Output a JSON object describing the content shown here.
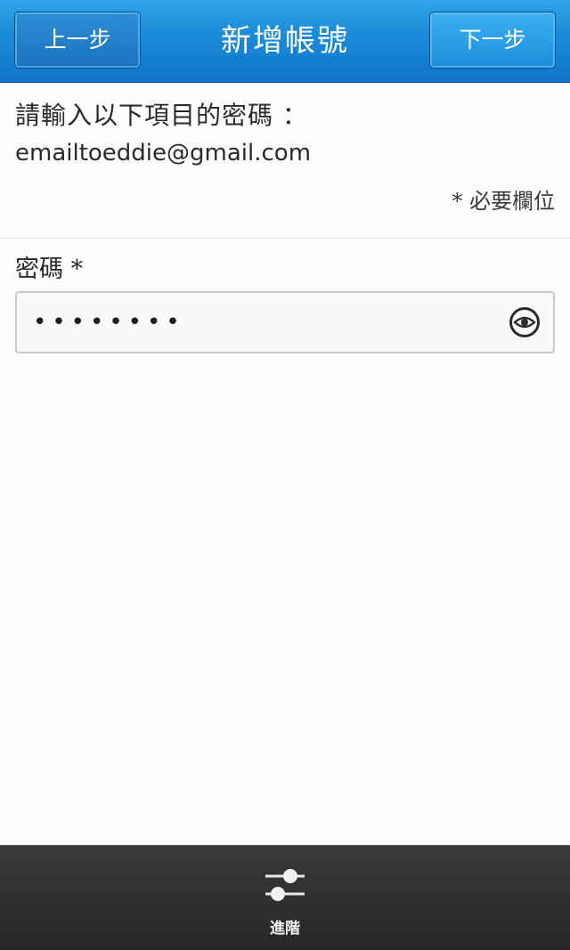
{
  "titlebar": {
    "back_label": "上一步",
    "title": "新增帳號",
    "next_label": "下一步"
  },
  "prompt": {
    "line1": "請輸入以下項目的密碼 ：",
    "email": "emailtoeddie@gmail.com"
  },
  "required_note": "* 必要欄位",
  "password_field": {
    "label": "密碼 *",
    "masked_value": "••••••••"
  },
  "actionbar": {
    "advanced_label": "進階"
  },
  "icons": {
    "show_password": "eye-icon",
    "advanced": "sliders-icon"
  },
  "colors": {
    "titlebar_blue": "#1a8ad8",
    "actionbar_dark": "#2b2b2b"
  }
}
